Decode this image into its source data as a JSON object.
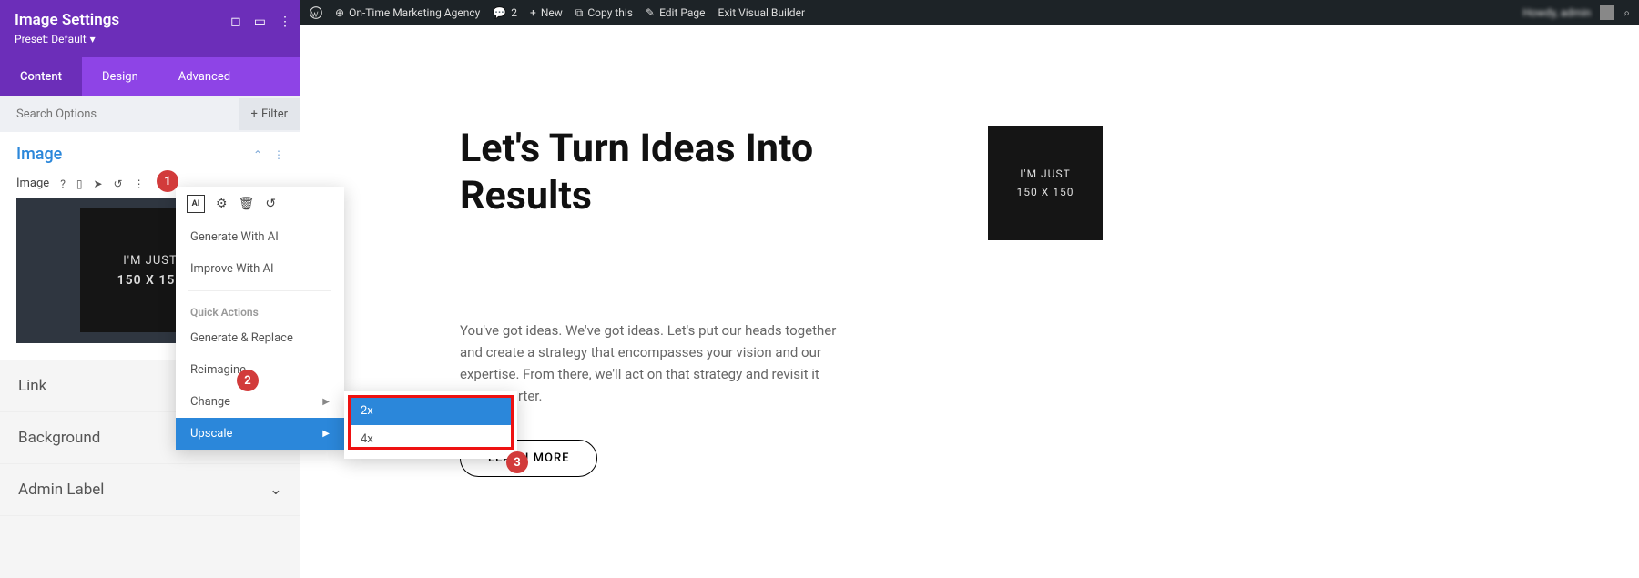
{
  "sidebar": {
    "title": "Image Settings",
    "preset": "Preset: Default",
    "tabs": {
      "content": "Content",
      "design": "Design",
      "advanced": "Advanced"
    },
    "search_placeholder": "Search Options",
    "filter": "Filter",
    "image_section": "Image",
    "field_label": "Image",
    "thumb_line1": "I'M JUST",
    "thumb_line2": "150 X 150",
    "accordion": {
      "link": "Link",
      "bg": "Background",
      "admin": "Admin Label"
    }
  },
  "ai_menu": {
    "generate": "Generate With AI",
    "improve": "Improve With AI",
    "quick_header": "Quick Actions",
    "gen_replace": "Generate & Replace",
    "reimagine": "Reimagine",
    "change": "Change",
    "upscale": "Upscale"
  },
  "submenu": {
    "x2": "2x",
    "x4": "4x"
  },
  "badges": {
    "one": "1",
    "two": "2",
    "three": "3"
  },
  "wpbar": {
    "site": "On-Time Marketing Agency",
    "comments": "2",
    "new": "New",
    "copy": "Copy this",
    "edit": "Edit Page",
    "exit": "Exit Visual Builder",
    "user": "Howdy, admin"
  },
  "content": {
    "h1": "Let's Turn Ideas Into Results",
    "p": "You've got ideas. We've got ideas. Let's put our heads together and create a strategy that encompasses your vision and our expertise. From there, we'll act on that strategy and revisit it every qaurter.",
    "btn": "LEARN MORE",
    "img_line1": "I'M JUST",
    "img_line2": "150 X 150"
  }
}
